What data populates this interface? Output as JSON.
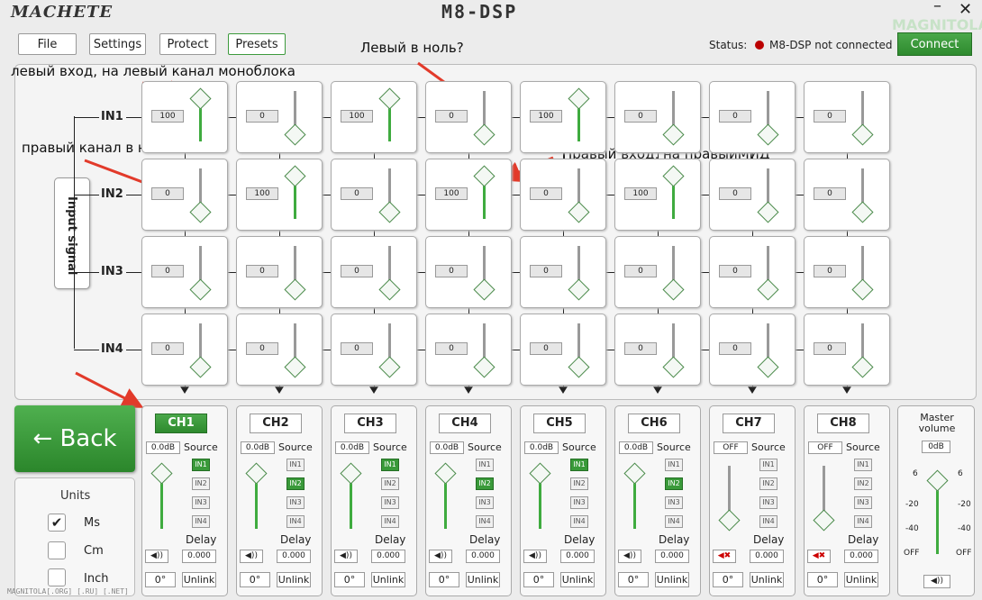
{
  "app": {
    "logo": "MACHETE",
    "title": "M8-DSP",
    "min": "–",
    "close": "✕"
  },
  "menu": {
    "file": "File",
    "settings": "Settings",
    "protect": "Protect",
    "presets": "Presets"
  },
  "status": {
    "label": "Status:",
    "text": "M8-DSP not connected",
    "connect": "Connect"
  },
  "watermark": "MAGNITOLA",
  "inputs": [
    "IN1",
    "IN2",
    "IN3",
    "IN4"
  ],
  "input_signal": "Input signal",
  "matrix": [
    [
      100,
      0,
      100,
      0,
      100,
      0,
      0,
      0
    ],
    [
      0,
      100,
      0,
      100,
      0,
      100,
      0,
      0
    ],
    [
      0,
      0,
      0,
      0,
      0,
      0,
      0,
      0
    ],
    [
      0,
      0,
      0,
      0,
      0,
      0,
      0,
      0
    ]
  ],
  "annotations": {
    "a1": "левый вход, на левый канал моноблока",
    "a2": "Левый в ноль?",
    "a3": "правый канал в ноль?",
    "a4": "Правый вход, на правыйМИД"
  },
  "back": "← Back",
  "units": {
    "title": "Units",
    "ms": "Ms",
    "cm": "Cm",
    "inch": "Inch",
    "check": "✔"
  },
  "source_label": "Source",
  "delay_label": "Delay",
  "src_buttons": [
    "IN1",
    "IN2",
    "IN3",
    "IN4"
  ],
  "channels": [
    {
      "name": "CH1",
      "gain": "0.0dB",
      "src": "IN1",
      "delay": "0.000",
      "phase": "0°",
      "link": "Unlink",
      "muted": false,
      "level": 1
    },
    {
      "name": "CH2",
      "gain": "0.0dB",
      "src": "IN2",
      "delay": "0.000",
      "phase": "0°",
      "link": "Unlink",
      "muted": false,
      "level": 1
    },
    {
      "name": "CH3",
      "gain": "0.0dB",
      "src": "IN1",
      "delay": "0.000",
      "phase": "0°",
      "link": "Unlink",
      "muted": false,
      "level": 1
    },
    {
      "name": "CH4",
      "gain": "0.0dB",
      "src": "IN2",
      "delay": "0.000",
      "phase": "0°",
      "link": "Unlink",
      "muted": false,
      "level": 1
    },
    {
      "name": "CH5",
      "gain": "0.0dB",
      "src": "IN1",
      "delay": "0.000",
      "phase": "0°",
      "link": "Unlink",
      "muted": false,
      "level": 1
    },
    {
      "name": "CH6",
      "gain": "0.0dB",
      "src": "IN2",
      "delay": "0.000",
      "phase": "0°",
      "link": "Unlink",
      "muted": false,
      "level": 1
    },
    {
      "name": "CH7",
      "gain": "OFF",
      "src": "",
      "delay": "0.000",
      "phase": "0°",
      "link": "Unlink",
      "muted": true,
      "level": 0
    },
    {
      "name": "CH8",
      "gain": "OFF",
      "src": "",
      "delay": "0.000",
      "phase": "0°",
      "link": "Unlink",
      "muted": true,
      "level": 0
    }
  ],
  "master": {
    "title1": "Master",
    "title2": "volume",
    "value": "0dB",
    "ticks": [
      "6",
      "-20",
      "-40",
      "OFF"
    ],
    "level": 1
  },
  "footer": "MAGNITOLA[.ORG] [.RU] [.NET]"
}
